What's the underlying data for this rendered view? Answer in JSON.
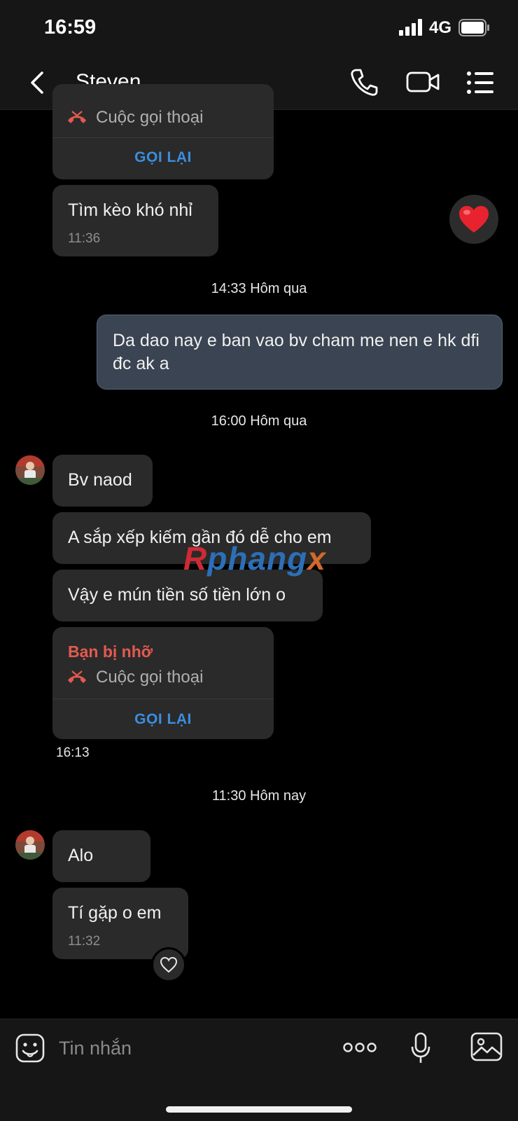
{
  "status_bar": {
    "time": "16:59",
    "network": "4G"
  },
  "header": {
    "contact_name": "Steven"
  },
  "messages": {
    "missed_call_top": {
      "call_label": "Cuộc gọi thoại",
      "callback_label": "GỌI LẠI"
    },
    "msg1": {
      "text": "Tìm kèo khó nhỉ",
      "time": "11:36"
    },
    "divider1": "14:33 Hôm qua",
    "sent1": {
      "text": "Da dao nay e ban vao bv cham me nen e hk dfi đc ak a"
    },
    "divider2": "16:00 Hôm qua",
    "msg2": {
      "text": "Bv naod"
    },
    "msg3": {
      "text": "A sắp xếp kiếm gần đó dễ cho em"
    },
    "msg4": {
      "text": "Vậy e mún tiền số tiền lớn o"
    },
    "missed_call_bottom": {
      "title": "Bạn bị nhỡ",
      "call_label": "Cuộc gọi thoại",
      "callback_label": "GỌI LẠI",
      "time": "16:13"
    },
    "divider3": "11:30 Hôm nay",
    "msg5": {
      "text": "Alo"
    },
    "msg6": {
      "text": "Tí gặp o em",
      "time": "11:32"
    }
  },
  "watermark": {
    "part1": "R",
    "part2": "phang",
    "part3": "x"
  },
  "input_bar": {
    "placeholder": "Tin nhắn"
  },
  "colors": {
    "accent_blue": "#3b8ee0",
    "missed_red": "#e35a50",
    "heart_red": "#e8232f",
    "sent_bubble": "#3a4452"
  },
  "icons": [
    "back-icon",
    "phone-icon",
    "video-icon",
    "menu-icon",
    "heart-icon",
    "missed-call-icon",
    "emoji-icon",
    "more-icon",
    "mic-icon",
    "image-icon"
  ]
}
